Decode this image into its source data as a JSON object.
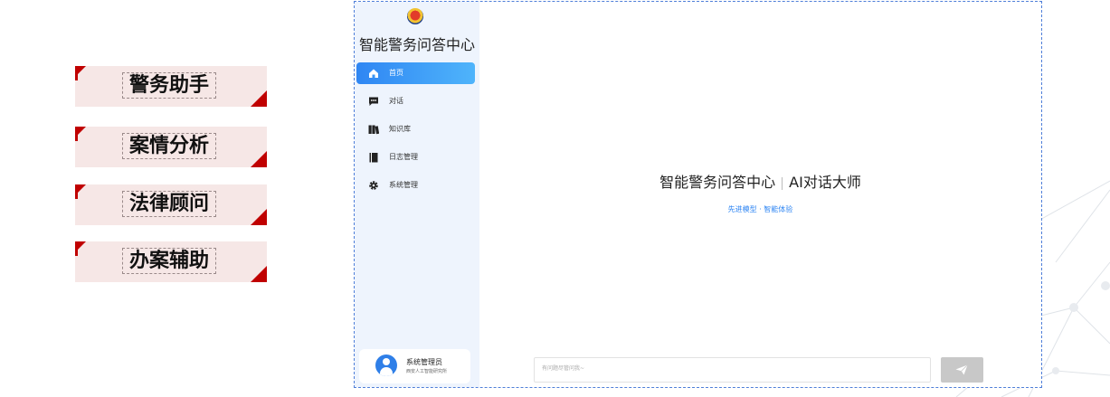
{
  "features": [
    {
      "label": "警务助手"
    },
    {
      "label": "案情分析"
    },
    {
      "label": "法律顾问"
    },
    {
      "label": "办案辅助"
    }
  ],
  "app": {
    "title": "智能警务问答中心",
    "nav": [
      {
        "label": "首页",
        "icon": "home-icon",
        "active": true
      },
      {
        "label": "对话",
        "icon": "chat-icon",
        "active": false
      },
      {
        "label": "知识库",
        "icon": "book-icon",
        "active": false
      },
      {
        "label": "日志管理",
        "icon": "log-icon",
        "active": false
      },
      {
        "label": "系统管理",
        "icon": "gear-icon",
        "active": false
      }
    ],
    "user": {
      "name": "系统管理员",
      "org": "西安人工智能研究所"
    }
  },
  "main": {
    "hero_title_left": "智能警务问答中心",
    "hero_title_right": "AI对话大师",
    "hero_subtitle": "先进模型 · 智能体验",
    "input_placeholder": "有问题尽管问我~"
  },
  "colors": {
    "accent": "#2f86f3",
    "brand_red": "#c00000",
    "card_bg": "#f6e7e6"
  }
}
